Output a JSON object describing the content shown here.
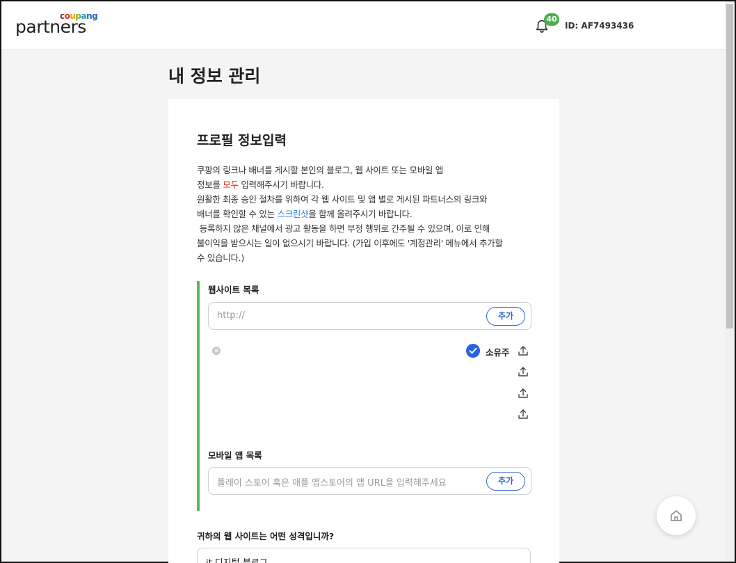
{
  "header": {
    "logo_top": [
      "c",
      "o",
      "u",
      "p",
      "a",
      "ng"
    ],
    "logo_main": "partners",
    "notification_count": "40",
    "user_id": "ID: AF7493436"
  },
  "page": {
    "title": "내 정보 관리"
  },
  "profile": {
    "section_title": "프로필 정보입력",
    "desc": {
      "l1": "쿠팡의 링크나 배너를 게시할 본인의 블로그, 웹 사이트 또는 모바일 앱",
      "l2a": "정보를 ",
      "l2b": "모두",
      "l2c": " 입력해주시기 바랍니다.",
      "l3": "원활한 최종 승인 절차를 위하여 각 웹 사이트 및 앱 별로 게시된 파트너스의 링크와",
      "l4a": "배너를 확인할 수 있는 ",
      "l4b": "스크린샷",
      "l4c": "을 함께 올려주시기 바랍니다.",
      "l5": " 등록하지 않은 채널에서 광고 활동을 하면 부정 행위로 간주될 수 있으며, 이로 인해",
      "l6": "불이익을 받으시는 일이 없으시기 바랍니다. (가입 이후에도 '계정관리' 메뉴에서 추가할",
      "l7": "수 있습니다.)"
    },
    "website_list": {
      "label": "웹사이트 목록",
      "placeholder": "http://",
      "add_label": "추가",
      "owner_label": "소유주"
    },
    "app_list": {
      "label": "모바일 앱 목록",
      "placeholder": "플레이 스토어 혹은 애플 앱스토어의 앱 URL을 입력해주세요",
      "add_label": "추가"
    },
    "site_type": {
      "question": "귀하의 웹 사이트는 어떤 성격입니까?",
      "value": "it 디지털 블로그"
    }
  },
  "colors": {
    "accent_green": "#5cb85c",
    "accent_blue": "#2a62c9",
    "highlight_red": "#e0301e",
    "link_blue": "#2a7de1",
    "badge_green": "#4caf50"
  }
}
